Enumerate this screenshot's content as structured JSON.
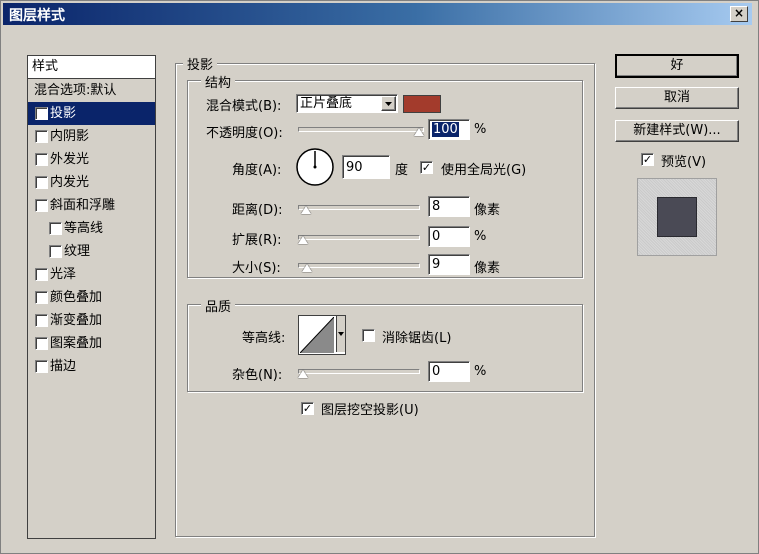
{
  "window": {
    "title": "图层样式",
    "close_glyph": "×"
  },
  "styles_list": {
    "header": "样式",
    "items": [
      {
        "label": "混合选项:默认",
        "checkbox": false,
        "selected": false,
        "sub": false
      },
      {
        "label": "投影",
        "checkbox": true,
        "checked": true,
        "selected": true,
        "sub": false
      },
      {
        "label": "内阴影",
        "checkbox": true,
        "checked": false,
        "selected": false,
        "sub": false
      },
      {
        "label": "外发光",
        "checkbox": true,
        "checked": false,
        "selected": false,
        "sub": false
      },
      {
        "label": "内发光",
        "checkbox": true,
        "checked": false,
        "selected": false,
        "sub": false
      },
      {
        "label": "斜面和浮雕",
        "checkbox": true,
        "checked": false,
        "selected": false,
        "sub": false
      },
      {
        "label": "等高线",
        "checkbox": true,
        "checked": false,
        "selected": false,
        "sub": true
      },
      {
        "label": "纹理",
        "checkbox": true,
        "checked": false,
        "selected": false,
        "sub": true
      },
      {
        "label": "光泽",
        "checkbox": true,
        "checked": false,
        "selected": false,
        "sub": false
      },
      {
        "label": "颜色叠加",
        "checkbox": true,
        "checked": false,
        "selected": false,
        "sub": false
      },
      {
        "label": "渐变叠加",
        "checkbox": true,
        "checked": false,
        "selected": false,
        "sub": false
      },
      {
        "label": "图案叠加",
        "checkbox": true,
        "checked": false,
        "selected": false,
        "sub": false
      },
      {
        "label": "描边",
        "checkbox": true,
        "checked": false,
        "selected": false,
        "sub": false
      }
    ]
  },
  "drop_shadow": {
    "group_title": "投影",
    "structure": {
      "title": "结构",
      "blend_mode_label": "混合模式(B):",
      "blend_mode_value": "正片叠底",
      "shadow_color": "#a33b2c",
      "opacity_label": "不透明度(O):",
      "opacity_value": "100",
      "opacity_unit": "%",
      "opacity_fraction": 1.0,
      "angle_label": "角度(A):",
      "angle_value": "90",
      "angle_unit": "度",
      "global_light_label": "使用全局光(G)",
      "global_light_checked": true,
      "distance_label": "距离(D):",
      "distance_value": "8",
      "distance_unit": "像素",
      "distance_fraction": 0.03,
      "spread_label": "扩展(R):",
      "spread_value": "0",
      "spread_unit": "%",
      "spread_fraction": 0.0,
      "size_label": "大小(S):",
      "size_value": "9",
      "size_unit": "像素",
      "size_fraction": 0.04
    },
    "quality": {
      "title": "品质",
      "contour_label": "等高线:",
      "anti_alias_label": "消除锯齿(L)",
      "anti_alias_checked": false,
      "noise_label": "杂色(N):",
      "noise_value": "0",
      "noise_unit": "%",
      "noise_fraction": 0.0
    },
    "knockout_label": "图层挖空投影(U)",
    "knockout_checked": true
  },
  "buttons": {
    "ok": "好",
    "cancel": "取消",
    "new_style": "新建样式(W)..."
  },
  "preview": {
    "label": "预览(V)",
    "checked": true
  },
  "check_glyph": "✓"
}
